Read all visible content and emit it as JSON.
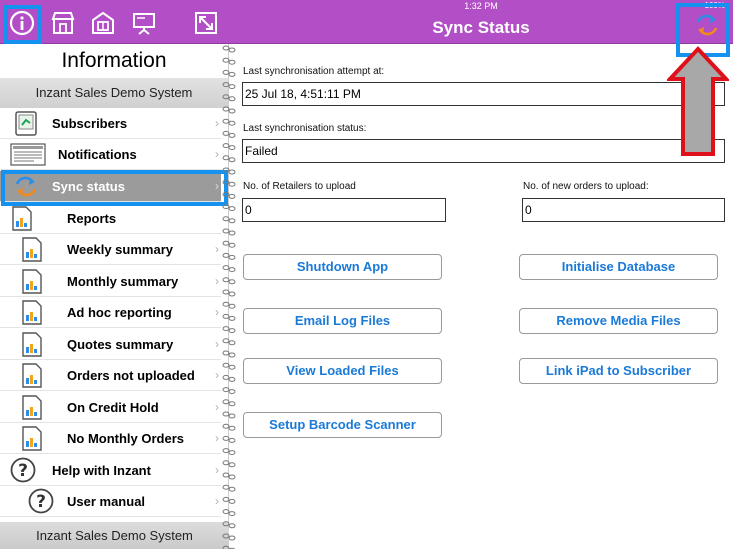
{
  "status_bar": {
    "time": "1:32 PM",
    "battery": "100%"
  },
  "toolbar": {
    "icons": [
      "info-icon",
      "store-icon",
      "catalogue-icon",
      "presentation-icon",
      "expand-icon"
    ]
  },
  "sidebar": {
    "title": "Information",
    "subtitle": "Inzant Sales Demo System",
    "footer": "Inzant Sales Demo System",
    "items": [
      {
        "label": "Subscribers",
        "icon": "subscribers-icon"
      },
      {
        "label": "Notifications",
        "icon": "notifications-icon"
      },
      {
        "label": "Sync status",
        "icon": "sync-icon",
        "active": true
      },
      {
        "label": "Reports",
        "icon": "report-icon"
      },
      {
        "label": "Weekly summary",
        "icon": "report-icon"
      },
      {
        "label": "Monthly summary",
        "icon": "report-icon"
      },
      {
        "label": "Ad hoc reporting",
        "icon": "report-icon"
      },
      {
        "label": "Quotes summary",
        "icon": "report-icon"
      },
      {
        "label": "Orders not uploaded",
        "icon": "report-icon"
      },
      {
        "label": "On Credit Hold",
        "icon": "report-icon"
      },
      {
        "label": "No Monthly Orders",
        "icon": "report-icon"
      },
      {
        "label": "Help with Inzant",
        "icon": "help-icon"
      },
      {
        "label": "User manual",
        "icon": "help-icon"
      }
    ]
  },
  "main": {
    "title": "Sync Status",
    "last_attempt_label": "Last synchronisation attempt at:",
    "last_attempt_value": "25 Jul 18, 4:51:11 PM",
    "last_status_label": "Last synchronisation status:",
    "last_status_value": "Failed",
    "retailers_label": "No. of Retailers to upload",
    "retailers_value": "0",
    "orders_label": "No. of new orders to upload:",
    "orders_value": "0",
    "buttons": {
      "shutdown": "Shutdown App",
      "initialise": "Initialise Database",
      "email_logs": "Email Log Files",
      "remove_media": "Remove Media Files",
      "view_loaded": "View Loaded Files",
      "link_ipad": "Link iPad to Subscriber",
      "barcode": "Setup Barcode Scanner"
    }
  },
  "colors": {
    "header": "#b34fc6",
    "highlight": "#1592f0",
    "arrow_fill": "#a8a8a8",
    "arrow_stroke": "#e0101a",
    "button_text": "#1a7ad8"
  }
}
